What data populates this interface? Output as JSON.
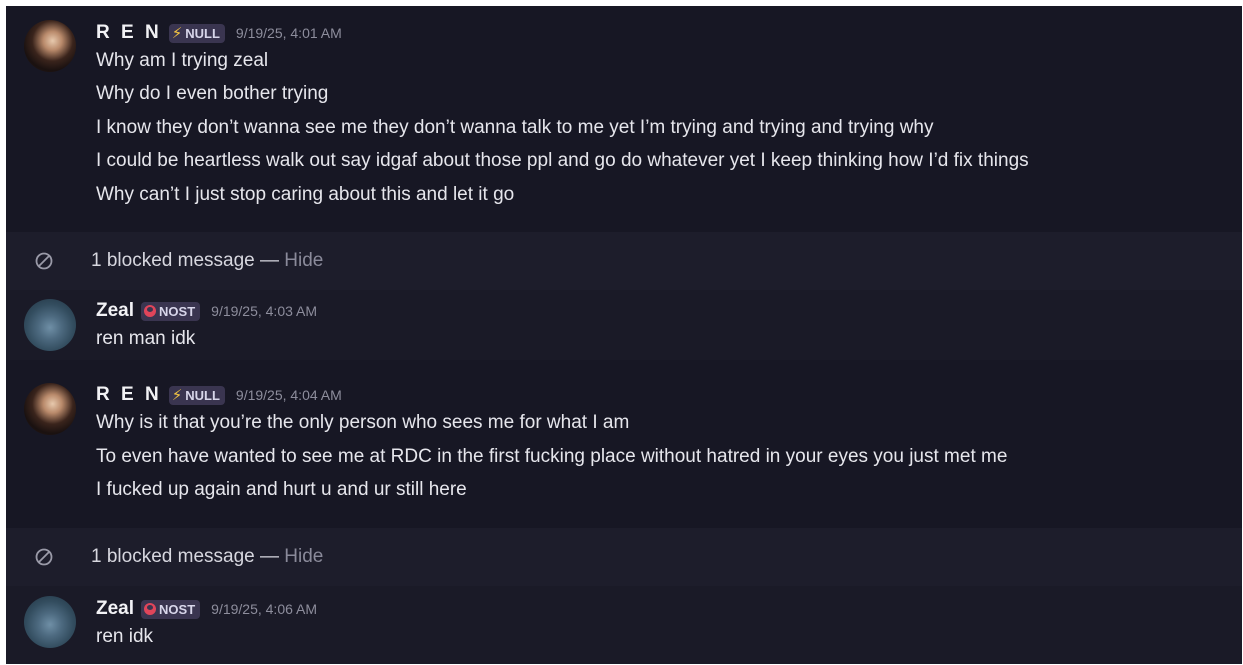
{
  "messages": [
    {
      "author": "R E N",
      "tag": "NULL",
      "tag_icon": "lightning-bolt-icon",
      "timestamp": "9/19/25, 4:01 AM",
      "lines": [
        "Why am I trying zeal",
        "Why do I even bother trying",
        "I know they don’t wanna see me they don’t wanna talk to me yet I’m trying and trying and trying why",
        "I could be heartless walk out say idgaf about those ppl and go do whatever yet I keep thinking how I’d fix things",
        "Why can’t I just stop caring about this and let it go"
      ]
    },
    {
      "author": "Zeal",
      "tag": "NOST",
      "tag_icon": "red-circle-icon",
      "timestamp": "9/19/25, 4:03 AM",
      "lines": [
        "ren man idk"
      ]
    },
    {
      "author": "R E N",
      "tag": "NULL",
      "tag_icon": "lightning-bolt-icon",
      "timestamp": "9/19/25, 4:04 AM",
      "lines": [
        "Why is it that you’re the only person who sees me for what I am",
        "To even have wanted to see me at RDC in the first fucking place without hatred in your eyes you just met me",
        "I fucked up again and hurt u and ur still here"
      ]
    },
    {
      "author": "Zeal",
      "tag": "NOST",
      "tag_icon": "red-circle-icon",
      "timestamp": "9/19/25, 4:06 AM",
      "lines": [
        "ren idk"
      ]
    }
  ],
  "blocked": [
    {
      "text": "1 blocked message —",
      "action": "Hide"
    },
    {
      "text": "1 blocked message —",
      "action": "Hide"
    }
  ],
  "colors": {
    "background": "#1a1a27",
    "text": "#e6e6ec",
    "muted": "#8d8d9c",
    "tag_bg": "#3a3550",
    "bolt": "#f5c542",
    "nost_red": "#e0455a"
  }
}
